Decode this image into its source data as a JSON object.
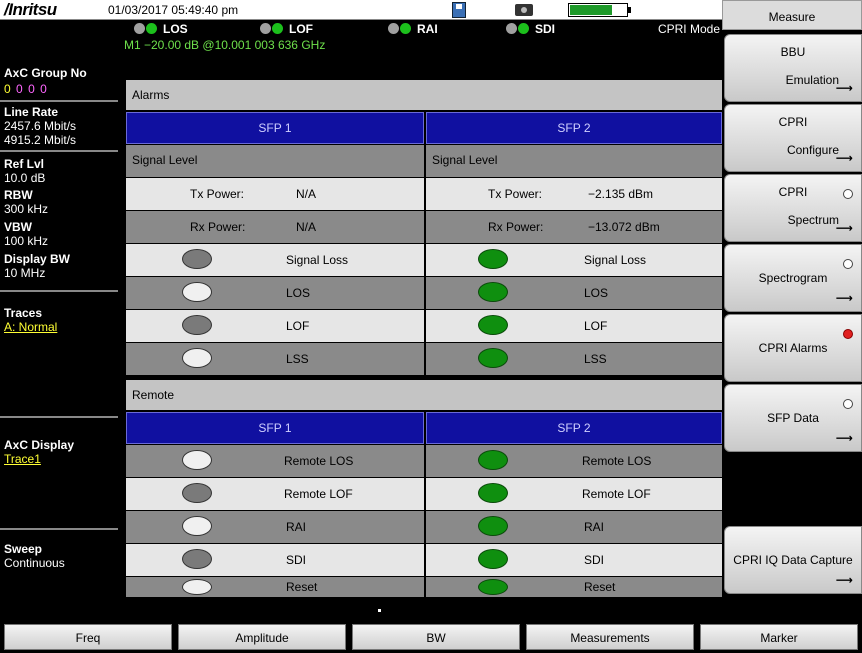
{
  "topbar": {
    "brand": "/Inritsu",
    "datetime": "01/03/2017 05:49:40 pm",
    "battery_level": 0.75
  },
  "status": {
    "indicators": [
      {
        "label": "LOS"
      },
      {
        "label": "LOF"
      },
      {
        "label": "RAI"
      },
      {
        "label": "SDI"
      }
    ],
    "mode": "CPRI Mode",
    "marker": "M1 −20.00 dB @10.001 003 636 GHz"
  },
  "left": {
    "axc_group_title": "AxC Group No",
    "axc_group_values": [
      "0",
      "0",
      "0",
      "0"
    ],
    "line_rate_title": "Line Rate",
    "line_rate_1": "2457.6 Mbit/s",
    "line_rate_2": "4915.2 Mbit/s",
    "ref_lvl_title": "Ref Lvl",
    "ref_lvl_value": "10.0 dB",
    "rbw_title": "RBW",
    "rbw_value": "300 kHz",
    "vbw_title": "VBW",
    "vbw_value": "100 kHz",
    "display_bw_title": "Display BW",
    "display_bw_value": "10 MHz",
    "traces_title": "Traces",
    "traces_value": "A: Normal",
    "axc_display_title": "AxC Display",
    "axc_display_value": "Trace1",
    "sweep_title": "Sweep",
    "sweep_value": "Continuous"
  },
  "alarms": {
    "section": "Alarms",
    "sfp1": "SFP 1",
    "sfp2": "SFP 2",
    "signal_level": "Signal Level",
    "tx_label": "Tx Power:",
    "rx_label": "Rx Power:",
    "sfp1_tx": "N/A",
    "sfp1_rx": "N/A",
    "sfp2_tx": "−2.135 dBm",
    "sfp2_rx": "−13.072 dBm",
    "rows": [
      "Signal Loss",
      "LOS",
      "LOF",
      "LSS"
    ]
  },
  "remote": {
    "section": "Remote",
    "sfp1": "SFP 1",
    "sfp2": "SFP 2",
    "rows": [
      "Remote LOS",
      "Remote LOF",
      "RAI",
      "SDI",
      "Reset"
    ]
  },
  "softkeys": {
    "title": "Measure",
    "bbu_1": "BBU",
    "bbu_2": "Emulation",
    "cpri_conf_1": "CPRI",
    "cpri_conf_2": "Configure",
    "cpri_spec_1": "CPRI",
    "cpri_spec_2": "Spectrum",
    "spectrogram": "Spectrogram",
    "cpri_alarms": "CPRI Alarms",
    "sfp_data": "SFP Data",
    "iq_capture": "CPRI IQ Data Capture"
  },
  "bottom": {
    "freq": "Freq",
    "amplitude": "Amplitude",
    "bw": "BW",
    "measurements": "Measurements",
    "marker": "Marker"
  }
}
